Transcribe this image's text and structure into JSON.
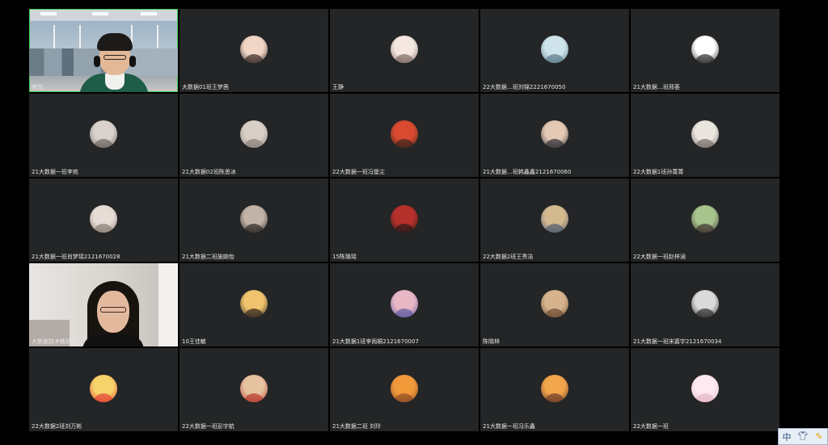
{
  "meeting": {
    "view": "gallery",
    "participants": [
      {
        "name": "李杰",
        "type": "video",
        "scene": "office",
        "speaking": true
      },
      {
        "name": "大数据01班王梦茜",
        "type": "avatar",
        "colors": [
          "#f1d6c6",
          "#3a2b26"
        ]
      },
      {
        "name": "王静",
        "type": "avatar",
        "colors": [
          "#f4e7e0",
          "#7f6a64"
        ]
      },
      {
        "name": "22大数据…班刘锦2221670050",
        "type": "avatar",
        "colors": [
          "#cfe3ea",
          "#5b7b8a"
        ]
      },
      {
        "name": "21大数据…班邢荟",
        "type": "avatar",
        "colors": [
          "#ffffff",
          "#2a2a2a"
        ]
      },
      {
        "name": "21大数据一班李宛",
        "type": "avatar",
        "colors": [
          "#d9d2cc",
          "#6d655f"
        ]
      },
      {
        "name": "21大数据02班陈思冰",
        "type": "avatar",
        "colors": [
          "#d8cfc6",
          "#8a8079"
        ]
      },
      {
        "name": "22大数据一班冯堡尘",
        "type": "avatar",
        "colors": [
          "#d94a31",
          "#3a241c"
        ]
      },
      {
        "name": "21大数据…班韩鑫鑫2121670060",
        "type": "avatar",
        "colors": [
          "#e4c9b4",
          "#2b2b33"
        ]
      },
      {
        "name": "22大数据1班孙菁菁",
        "type": "avatar",
        "colors": [
          "#eae5df",
          "#756c66"
        ]
      },
      {
        "name": "21大数据一班肖梦瑶2121670028",
        "type": "avatar",
        "colors": [
          "#e6dcd6",
          "#8c7e74"
        ]
      },
      {
        "name": "21大数据二班施婉怡",
        "type": "avatar",
        "colors": [
          "#c2b3a7",
          "#2b2623"
        ]
      },
      {
        "name": "15陈璐瑶",
        "type": "avatar",
        "colors": [
          "#b5302b",
          "#2a1a18"
        ]
      },
      {
        "name": "22大数据2班王秀洁",
        "type": "avatar",
        "colors": [
          "#d3b98e",
          "#4e5d6d"
        ]
      },
      {
        "name": "22大数据一班赵梓涵",
        "type": "avatar",
        "colors": [
          "#a7c48c",
          "#3e3330"
        ]
      },
      {
        "name": "大数据技术教研室",
        "type": "video",
        "scene": "room"
      },
      {
        "name": "10王佳敏",
        "type": "avatar",
        "colors": [
          "#f0c36e",
          "#2c211c"
        ]
      },
      {
        "name": "21大数据1班李雨桐2121670007",
        "type": "avatar",
        "colors": [
          "#e8b7c6",
          "#5b5a9c"
        ]
      },
      {
        "name": "陈晓林",
        "type": "avatar",
        "colors": [
          "#d6b38d",
          "#6c4b34"
        ]
      },
      {
        "name": "21大数据一班宋嘉宇2121670034",
        "type": "avatar",
        "colors": [
          "#dadada",
          "#2a2a2a"
        ]
      },
      {
        "name": "22大数据2班刘万彬",
        "type": "avatar",
        "colors": [
          "#f7d36b",
          "#e24334"
        ]
      },
      {
        "name": "22大数据一班彭宇航",
        "type": "avatar",
        "colors": [
          "#e5c2a0",
          "#b7392e"
        ]
      },
      {
        "name": "21大数据二班 刘玲",
        "type": "avatar",
        "colors": [
          "#f19a3b",
          "#8f4b26"
        ]
      },
      {
        "name": "21大数据一班冯乐鑫",
        "type": "avatar",
        "colors": [
          "#f2a64b",
          "#6e3c2a"
        ]
      },
      {
        "name": "22大数据一班",
        "type": "avatar",
        "colors": [
          "#fde9ef",
          "#e6b8c8"
        ]
      }
    ]
  },
  "ime_toolbar": {
    "mode_label": "中",
    "skin_icon": "shirt-icon",
    "pen_icon": "pen-icon"
  }
}
